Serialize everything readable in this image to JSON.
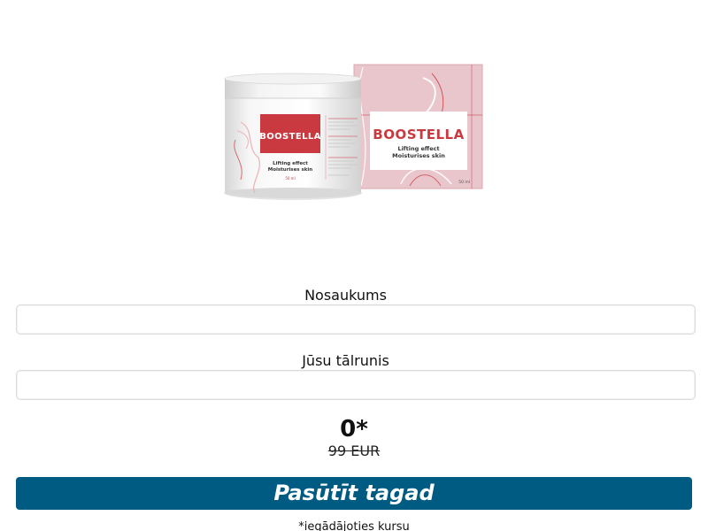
{
  "product": {
    "brand": "BOOSTELLA",
    "tagline_line1": "Lifting effect",
    "tagline_line2": "Moisturises skin",
    "volume": "50 ml"
  },
  "form": {
    "name_label": "Nosaukums",
    "name_value": "",
    "phone_label": "Jūsu tālrunis",
    "phone_value": ""
  },
  "price": {
    "new": "0*",
    "old": "99 EUR"
  },
  "order_button": {
    "label": "Pasūtīt tagad"
  },
  "footnote": "*iegādājoties kursu",
  "colors": {
    "accent": "#005b82",
    "brand_red": "#c9393f",
    "box_pink": "#e8c4c9"
  }
}
